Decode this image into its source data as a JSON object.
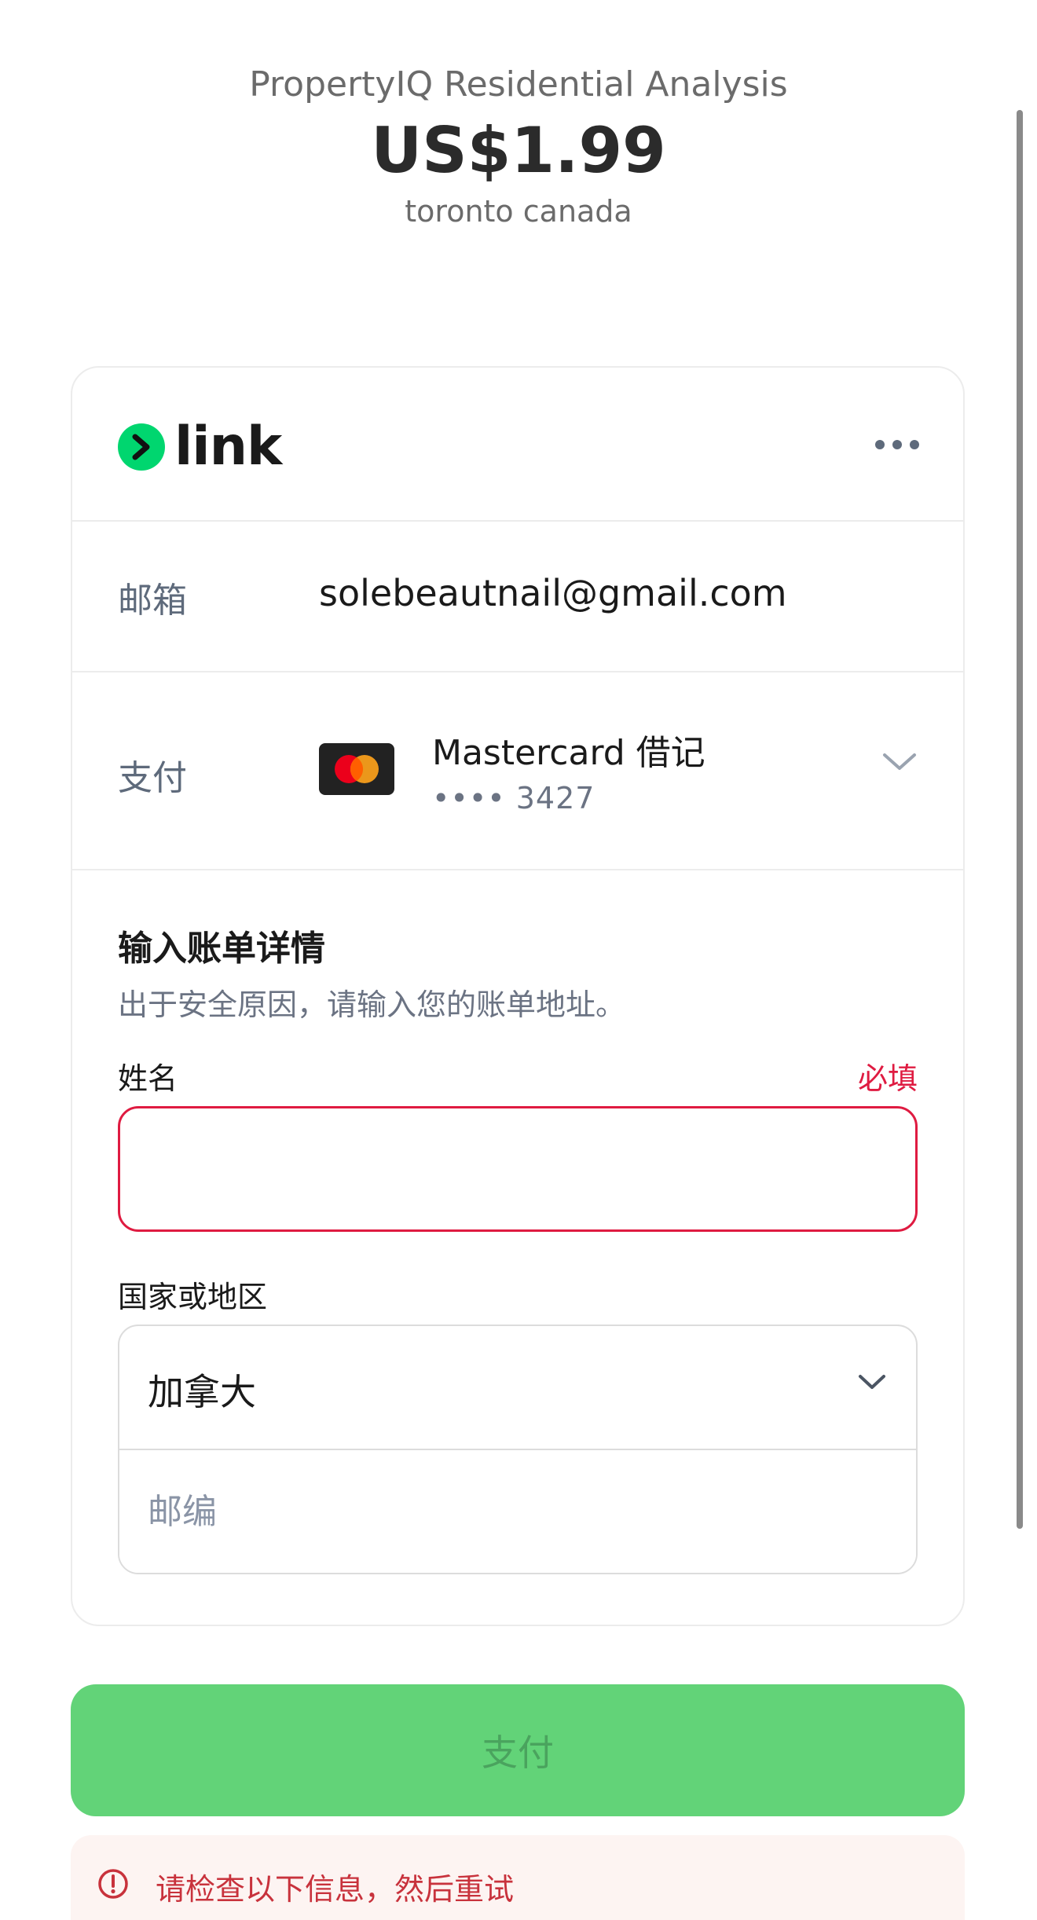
{
  "header": {
    "product_name": "PropertyIQ Residential Analysis",
    "price": "US$1.99",
    "location": "toronto canada"
  },
  "link": {
    "brand": "link",
    "brand_color": "#00d66f",
    "menu_icon": "more-horizontal-icon"
  },
  "email": {
    "label": "邮箱",
    "value": "solebeautnail@gmail.com"
  },
  "payment": {
    "label": "支付",
    "card_brand_icon": "mastercard-icon",
    "card_name": "Mastercard 借记",
    "card_number": "•••• 3427"
  },
  "billing": {
    "title": "输入账单详情",
    "subtitle": "出于安全原因，请输入您的账单地址。",
    "name_label": "姓名",
    "required": "必填",
    "name_value": "",
    "country_label": "国家或地区",
    "country_value": "加拿大",
    "postal_placeholder": "邮编"
  },
  "pay_button": {
    "label": "支付",
    "color": "#62d378"
  },
  "error": {
    "message": "请检查以下信息，然后重试",
    "color": "#c8323c"
  }
}
